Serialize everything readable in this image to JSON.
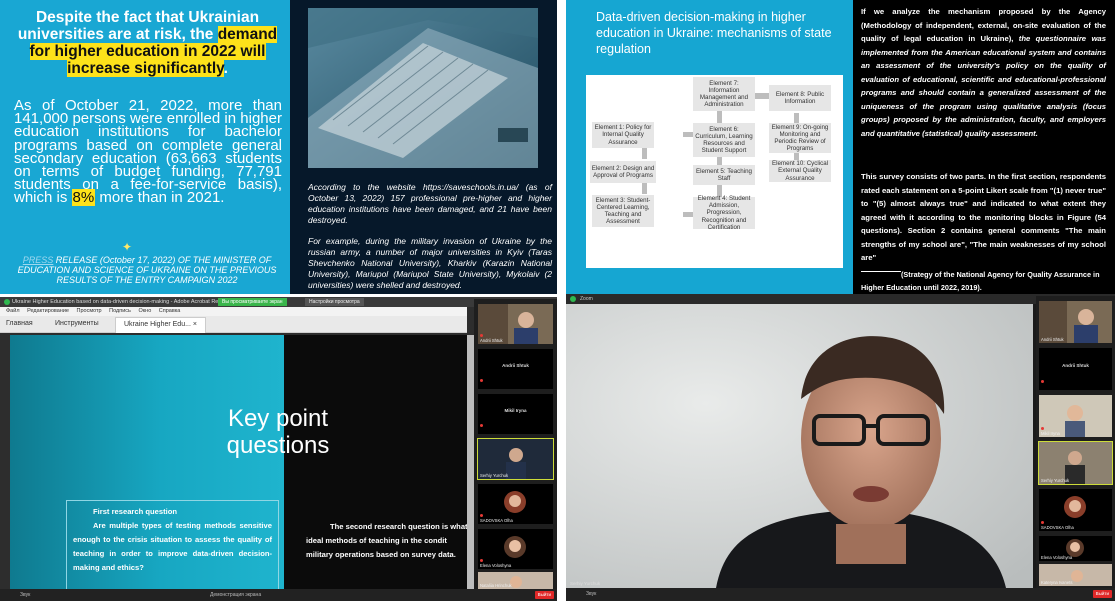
{
  "q1": {
    "headline_prefix": "Despite the fact that Ukrainian universities are at risk, the ",
    "headline_highlight": "demand for higher education in 2022 will increase significantly",
    "headline_suffix": ".",
    "body_main": "As of October 21, 2022, more than 141,000 persons were enrolled in higher education institutions for bachelor programs based on complete general secondary education (63,663 students on terms of budget funding, 77,791 students on a fee-for-service basis), which is ",
    "body_highlight": "8%",
    "body_end": " more than in 2021.",
    "source_link": "PRESS",
    "source_rest": " RELEASE (October 17, 2022) OF THE MINISTER OF EDUCATION AND SCIENCE OF UKRAINE ON THE PREVIOUS RESULTS OF THE ENTRY CAMPAIGN 2022",
    "para1": "According to the website https://saveschools.in.ua/ (as of October 13, 2022) 157 professional pre-higher and higher education institutions have been damaged, and 21 have been destroyed.",
    "para2": "For example, during the military invasion of Ukraine by the russian army, a number of major universities in Kyiv (Taras Shevchenko National University), Kharkiv (Karazin National University), Mariupol (Mariupol State University), Mykolaiv (2 universities) were shelled and destroyed.",
    "colors": {
      "teal": "#19a7d3",
      "highlight": "#fde21a",
      "navy": "#06182a"
    }
  },
  "q2": {
    "title": "Data-driven decision-making in higher education in Ukraine: mechanisms of state regulation",
    "elements": {
      "e1": "Element 1: Policy for Internal Quality Assurance",
      "e2": "Element 2: Design and Approval of Programs",
      "e3": "Element 3: Student-Centered Learning, Teaching and Assessment",
      "e4": "Element 4: Student Admission, Progression, Recognition and Certification",
      "e5": "Element 5: Teaching Staff",
      "e6": "Element 6: Curriculum, Learning Resources and Student Support",
      "e7": "Element 7: Information Management and Administration",
      "e8": "Element 8: Public Information",
      "e9": "Element 9: On-going Monitoring and Periodic Review of Programs",
      "e10": "Element 10: Cyclical External Quality Assurance"
    },
    "para1_a": "If we analyze the mechanism proposed by the Agency (Methodology of independent, external, on-site evaluation of the quality of legal education in Ukraine), ",
    "para1_b": "the questionnaire was implemented from the American educational system and contains an assessment of the university's policy on the quality of evaluation of educational, scientific and educational-professional programs and should contain a generalized assessment of the uniqueness of the program using qualitative analysis (focus groups) proposed by the administration, faculty, and employers and quantitative (statistical) quality assessment.",
    "para2": "This survey consists of two parts. In the first section, respondents rated each statement on a 5-point Likert scale from \"(1) never true\" to \"(5) almost always true\" and indicated to what extent they agreed with it according to the monitoring blocks in Figure (54 questions). Section 2 contains general comments \"The main strengths of my school are\", \"The main weaknesses of my school are\"",
    "strategy": "(Strategy of the National Agency for Quality Assurance in Higher Education until 2022, 2019)."
  },
  "q3": {
    "window_title": "Ukraine Higher Education based on data-driven decision-making - Adobe Acrobat Reader",
    "notice": "Вы просматриваете экран",
    "notice2": "Настройки просмотра",
    "menu": [
      "Файл",
      "Редактирование",
      "Просмотр",
      "Подпись",
      "Окно",
      "Справка"
    ],
    "tab_home": "Главная",
    "tab_tools": "Инструменты",
    "tab_doc": "Ukraine Higher Edu...",
    "tab_doc_close": "×",
    "slide_title": "Key point questions",
    "rq1_heading": "First research question",
    "rq1_text": "Are multiple types of testing methods sensitive enough to the crisis situation to assess the quality of teaching in order to improve data-driven decision-making and ethics?",
    "rq2_text": "The second research question is what ideal methods of teaching in the condit military operations based on survey data.",
    "participants": {
      "p1": "Andrii Shtuk",
      "p2": "Andrii Shtuk",
      "p3": "Mikil Iryna",
      "p4": "Mikil Iryna",
      "p5": "Serhiy Yurchuk",
      "p6": "SADOVSKA Olha",
      "p7": "Elena Voloshyna",
      "p8": "Nataliia Hrinchuk"
    },
    "leave_label": "Выйти",
    "bottom_left": "Звук",
    "bottom_mid": "Демонстрация экрана"
  },
  "q4": {
    "window_label": "Zoom",
    "speaker_name": "Serhiy Yurchuk",
    "participants": {
      "p1": "Andrii Shtuk",
      "p2": "Andrii Shtuk",
      "p3": "Mikil Iryna",
      "p4": "Serhiy Yurchuk",
      "p5": "SADOVSKA Olha",
      "p6": "Elena Voloshyna",
      "p7": "Kateryna Ivanets"
    },
    "leave_label": "Выйти",
    "bottom_left": "Звук"
  }
}
